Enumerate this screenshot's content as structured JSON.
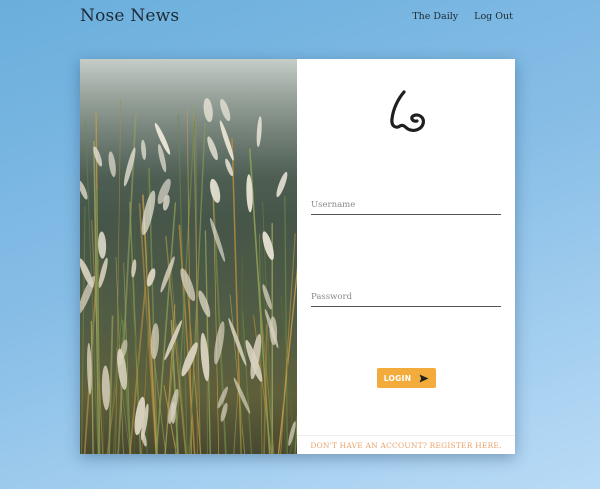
{
  "header": {
    "brand": "Nose News",
    "nav": [
      {
        "label": "The Daily"
      },
      {
        "label": "Log Out"
      }
    ]
  },
  "login_card": {
    "photo_icon": "grass-field-photo",
    "logo_icon": "nose-icon",
    "username": {
      "placeholder": "Username",
      "value": ""
    },
    "password": {
      "placeholder": "Password",
      "value": ""
    },
    "login_button": {
      "label": "LOGIN",
      "icon": "send-arrow-icon"
    },
    "register_link": "DON'T HAVE AN ACCOUNT? REGISTER HERE."
  },
  "colors": {
    "accent": "#f3ac3c",
    "link": "#e9a26b",
    "background_top": "#6aaedc",
    "background_bottom": "#b9dbf6"
  }
}
